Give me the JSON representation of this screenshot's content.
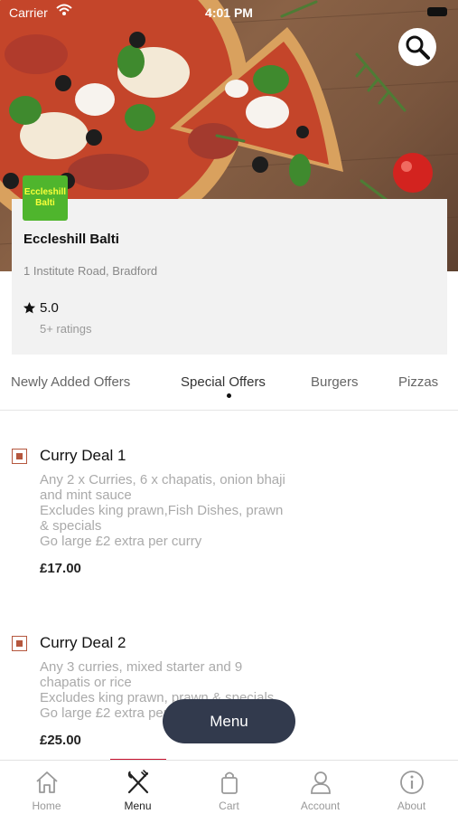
{
  "status_bar": {
    "carrier": "Carrier",
    "time": "4:01 PM"
  },
  "restaurant": {
    "logo_text_line1": "Eccleshill",
    "logo_text_line2": "Balti",
    "name": "Eccleshill Balti",
    "address": "1 Institute Road, Bradford",
    "rating": "5.0",
    "rating_count": "5+ ratings"
  },
  "tabs": [
    {
      "label": "Newly Added Offers"
    },
    {
      "label": "Special Offers"
    },
    {
      "label": "Burgers"
    },
    {
      "label": "Pizzas"
    }
  ],
  "active_tab": "Special Offers",
  "menu_items": [
    {
      "title": "Curry Deal 1",
      "description": [
        "Any 2 x Curries, 6 x chapatis, onion bhaji",
        "and mint sauce",
        "Excludes king prawn,Fish Dishes, prawn",
        "& specials",
        "Go large £2 extra per curry"
      ],
      "price": "£17.00"
    },
    {
      "title": "Curry Deal 2",
      "description": [
        "Any 3 curries, mixed starter and 9",
        "chapatis or rice",
        "Excludes king prawn, prawn & specials",
        "Go large £2 extra per curry"
      ],
      "price": "£25.00"
    }
  ],
  "floating_button": {
    "label": "Menu"
  },
  "bottom_nav": [
    {
      "label": "Home",
      "icon": "home-icon"
    },
    {
      "label": "Menu",
      "icon": "fork-knife-icon"
    },
    {
      "label": "Cart",
      "icon": "shopping-bag-icon"
    },
    {
      "label": "Account",
      "icon": "user-icon"
    },
    {
      "label": "About",
      "icon": "info-icon"
    }
  ],
  "active_nav": "Menu",
  "colors": {
    "accent": "#c8102e",
    "checkbox": "#b5573e",
    "floating_button": "#323a4d",
    "logo_bg": "#4fb52d"
  }
}
